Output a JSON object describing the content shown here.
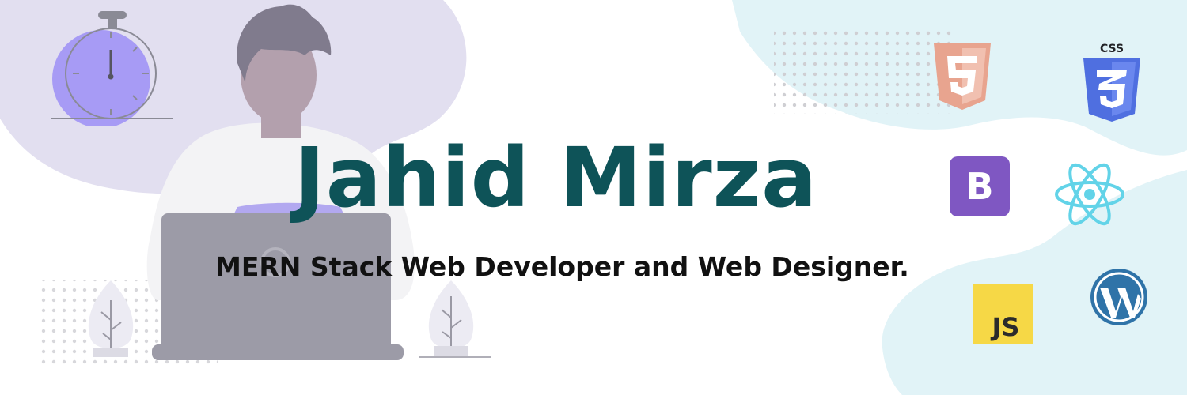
{
  "banner": {
    "name": "Jahid Mirza",
    "tagline": "MERN Stack Web Developer and Web Designer."
  },
  "logos": {
    "css_label": "CSS",
    "bootstrap_label": "B",
    "js_label": "JS"
  },
  "icons": [
    "stopwatch-icon",
    "html5-icon",
    "css3-icon",
    "bootstrap-icon",
    "react-icon",
    "javascript-icon",
    "wordpress-icon",
    "plant-icon"
  ],
  "colors": {
    "title": "#0e5358",
    "subtitle": "#111111",
    "left_blob": "#e2dff0",
    "right_blob": "#e1f3f7",
    "html5": "#e8a48f",
    "css3": "#4f6fe0",
    "bootstrap": "#7f57c2",
    "react": "#62d3e8",
    "javascript": "#f6d846",
    "wordpress": "#2f73a8"
  }
}
